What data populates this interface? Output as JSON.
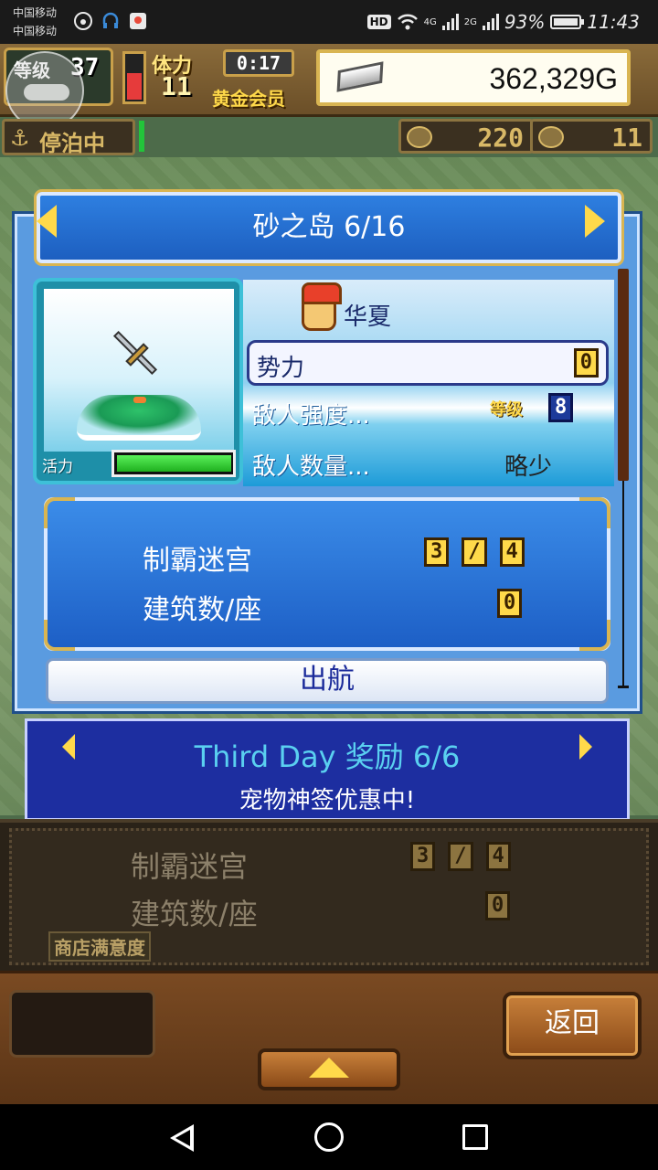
{
  "status_bar": {
    "carrier1": "中国移动",
    "carrier2": "中国移动",
    "hd": "HD",
    "net1": "4G",
    "net2": "2G",
    "battery": "93%",
    "time": "11:43"
  },
  "hud": {
    "level_label": "等级",
    "level": "37",
    "stamina_label": "体力",
    "stamina": "11",
    "timer": "0:17",
    "member": "黄金会员",
    "money": "362,329G",
    "status": "停泊中",
    "resource1": "220",
    "resource2": "11"
  },
  "dialog": {
    "title": "砂之岛 6/16",
    "vitality_label": "活力",
    "vitality_fill": 0.96,
    "leader_name": "华夏",
    "power_label": "势力",
    "power_value": "0",
    "enemy_strength_label": "敌人强度...",
    "level_tag": "等级",
    "level_value": "8",
    "enemy_count_label": "敌人数量...",
    "enemy_count_value": "略少",
    "stat1_label": "制霸迷宫",
    "stat1_value": "3",
    "stat1_sep": "/",
    "stat1_total": "4",
    "stat2_label": "建筑数/座",
    "stat2_value": "0",
    "sail_button": "出航"
  },
  "banner": {
    "title": "Third Day 奖励 6/6",
    "subtitle": "宠物神签优惠中!"
  },
  "background_panel": {
    "stat1_label": "制霸迷宫",
    "stat1_value": "3",
    "stat1_sep": "/",
    "stat1_total": "4",
    "stat2_label": "建筑数/座",
    "stat2_value": "0",
    "shop_satisfaction": "商店满意度"
  },
  "footer": {
    "back_button": "返回"
  },
  "colors": {
    "accent_gold": "#ffd94a",
    "dialog_blue": "#1d5fc0",
    "banner_blue": "#1d2ea0"
  }
}
